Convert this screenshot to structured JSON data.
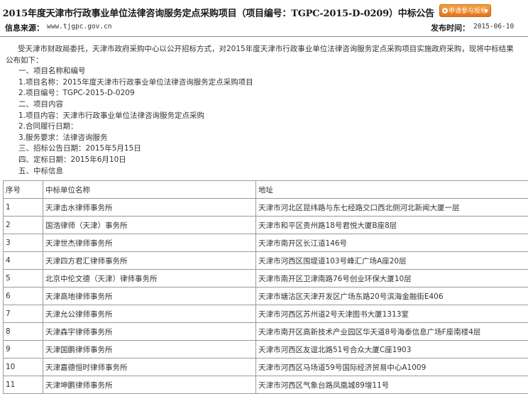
{
  "header": {
    "title": "2015年度天津市行政事业单位法律咨询服务定点采购项目（项目编号：TGPC-2015-D-0209）中标公告",
    "apply_button": "申请参与投标"
  },
  "meta": {
    "source_label": "信息来源：",
    "source_value": "www.tjgpc.gov.cn",
    "time_label": "发布时间：",
    "time_value": "2015-06-10"
  },
  "body": {
    "intro_1": "受天津市财政局委托，天津市政府采购中心以公开招标方式，对2015年度天津市行政事业单位法律咨询服务定点采购项目实施政府采购，现将中标结果",
    "intro_2": "公布如下：",
    "s1": "一、项目名称和编号",
    "s1_1": "1.项目名称：2015年度天津市行政事业单位法律咨询服务定点采购项目",
    "s1_2": "2.项目编号：TGPC-2015-D-0209",
    "s2": "二、项目内容",
    "s2_1": "1.项目内容：天津市行政事业单位法律咨询服务定点采购",
    "s2_2": "2.合同履行日期：",
    "s2_3": "3.服务要求：法律咨询服务",
    "s3": "三、招标公告日期：2015年5月15日",
    "s4": "四、定标日期：2015年6月10日",
    "s5": "五、中标信息"
  },
  "table": {
    "headers": [
      "序号",
      "中标单位名称",
      "地址"
    ],
    "rows": [
      [
        "1",
        "天津击水律师事务所",
        "天津市河北区昆纬路与东七经路交口西北侧河北新闻大厦一层"
      ],
      [
        "2",
        "国浩律师（天津）事务所",
        "天津市和平区贵州路18号君悦大厦B座8层"
      ],
      [
        "3",
        "天津世杰律师事务所",
        "天津市南开区长江道146号"
      ],
      [
        "4",
        "天津四方君汇律师事务所",
        "天津市河西区围堤道103号峰汇广场A座20层"
      ],
      [
        "5",
        "北京中伦文德（天津）律师事务所",
        "天津市南开区卫津南路76号创业环保大厦10层"
      ],
      [
        "6",
        "天津高地律师事务所",
        "天津市塘沽区天津开发区广场东路20号滨海金融街E406"
      ],
      [
        "7",
        "天津允公律师事务所",
        "天津市河西区苏州道2号天津图书大厦1313室"
      ],
      [
        "8",
        "天津森宇律师事务所",
        "天津市南开区高新技术产业园区华天道8号海泰信息广场F座南楼4层"
      ],
      [
        "9",
        "天津国鹏律师事务所",
        "天津市河西区友谊北路51号合众大厦C座1903"
      ],
      [
        "10",
        "天津嘉德恒时律师事务所",
        "天津市河西区马场道59号国际经济贸易中心A1009"
      ],
      [
        "11",
        "天津坤鹏律师事务所",
        "天津市河西区气象台路凤凰城89增11号"
      ]
    ]
  },
  "colors": {
    "button_orange": "#e4731a",
    "divider": "#8a8a8a",
    "table_border": "#9a9a9a"
  }
}
